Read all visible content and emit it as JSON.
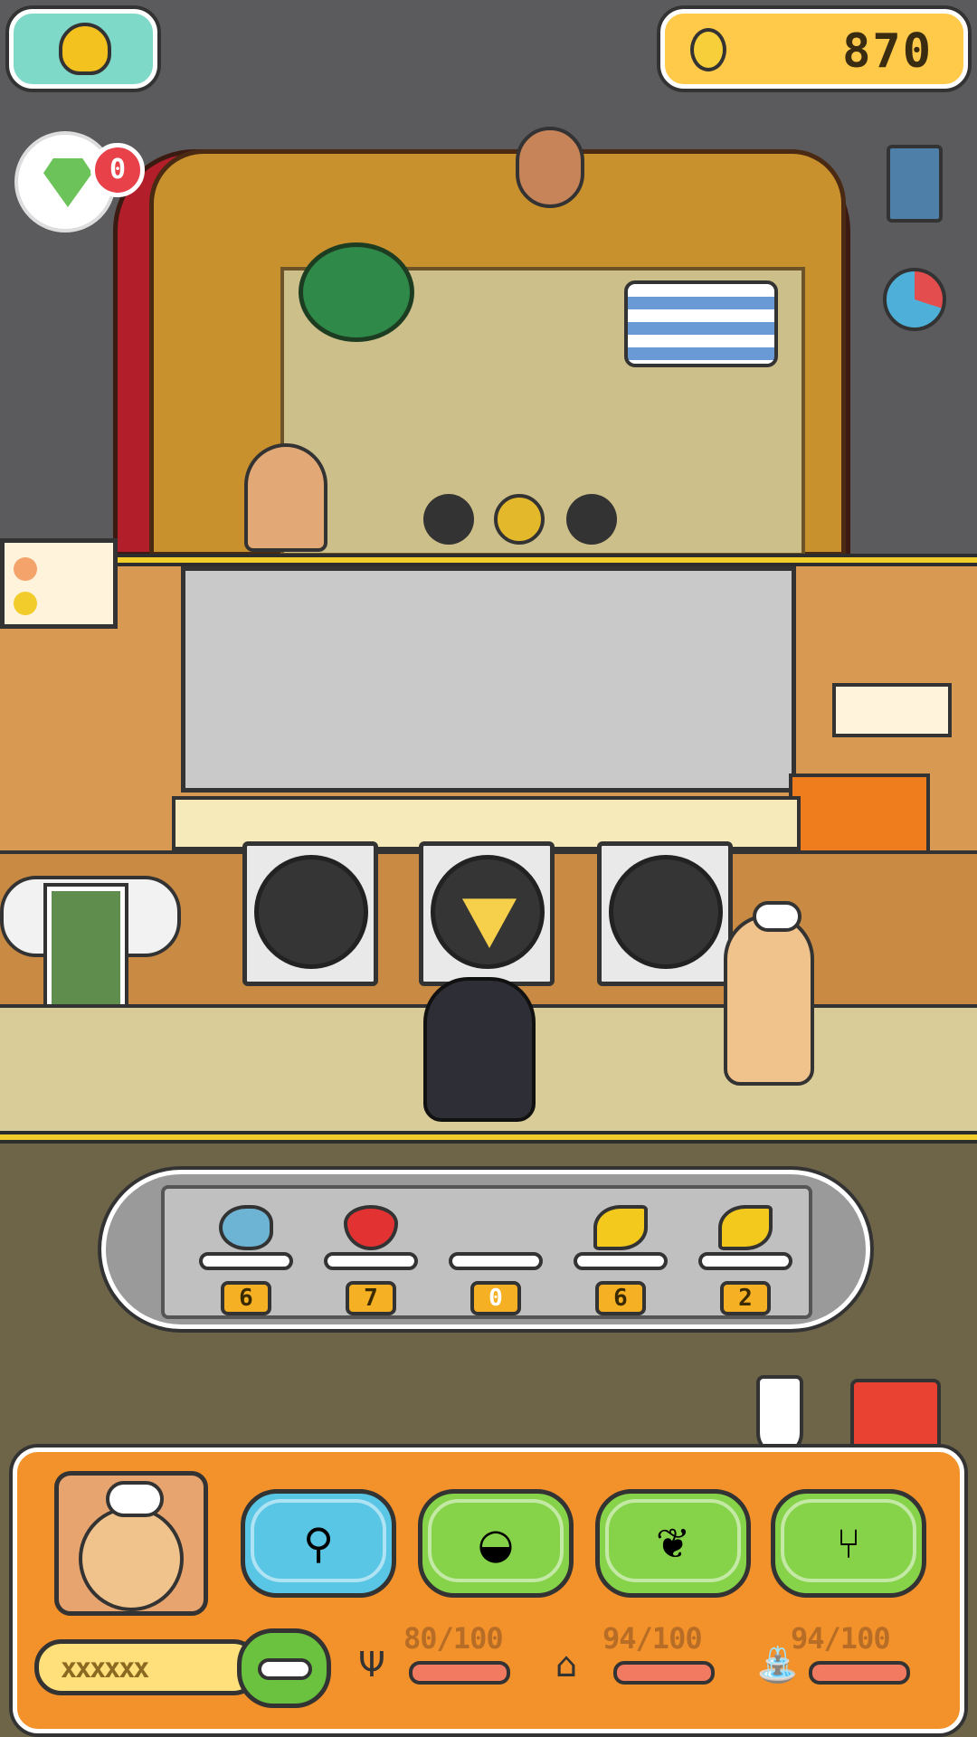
{
  "hud": {
    "coins": "870",
    "gem_badge_count": "0",
    "icons": [
      "gold-sack-icon",
      "coin-icon",
      "gem-icon",
      "menu-book-icon",
      "pie-chart-icon"
    ]
  },
  "ingredients": [
    {
      "name": "fish-icon",
      "count": "6"
    },
    {
      "name": "strawberry-icon",
      "count": "7"
    },
    {
      "name": "empty-slot",
      "count": "0"
    },
    {
      "name": "banana-icon",
      "count": "6"
    },
    {
      "name": "banana-icon",
      "count": "2"
    }
  ],
  "actions": [
    {
      "name": "whisk-icon",
      "glyph": "⚲"
    },
    {
      "name": "crepe-icon",
      "glyph": "◒"
    },
    {
      "name": "fruit-icon",
      "glyph": "❦"
    },
    {
      "name": "utensils-icon",
      "glyph": "⑂"
    }
  ],
  "stats": {
    "hunger": "80/100",
    "energy": "94/100",
    "hygiene": "94/100",
    "hunger_fraction": 0.8,
    "energy_fraction": 0.94,
    "hygiene_fraction": 0.94
  },
  "xp": {
    "text": "xxxxxx"
  },
  "colors": {
    "accent": "#f3912b",
    "stripe": "#f2cc2a"
  }
}
